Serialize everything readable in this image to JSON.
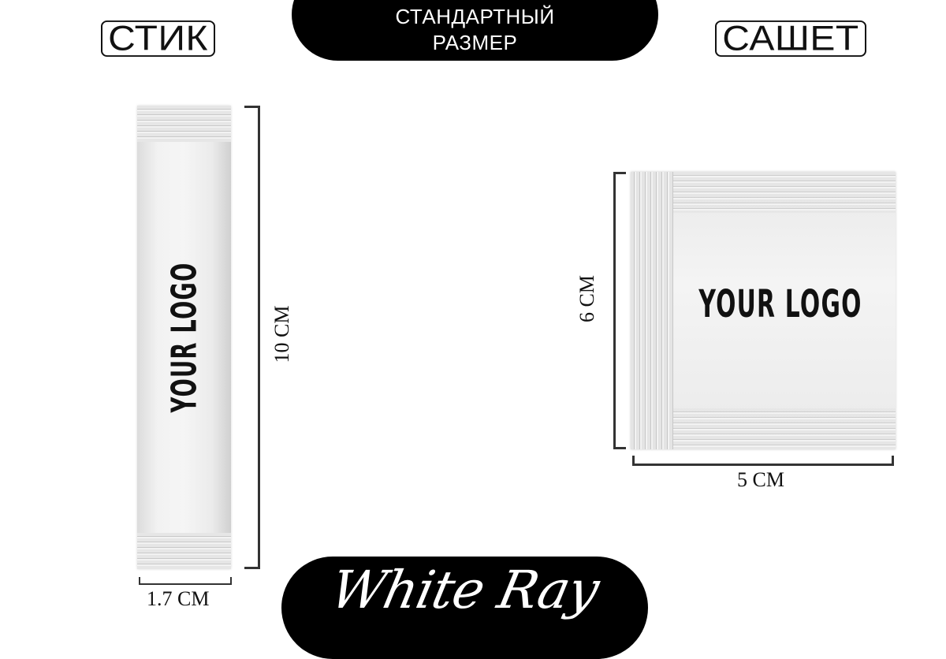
{
  "header": {
    "stick_label": "СТИК",
    "sachet_label": "САШЕТ",
    "center_line1": "СТАНДАРТНЫЙ",
    "center_line2": "РАЗМЕР"
  },
  "stick": {
    "logo_text": "YOUR LOGO",
    "height_label": "10 CM",
    "width_label": "1.7 CM"
  },
  "sachet": {
    "logo_text": "YOUR LOGO",
    "height_label": "6 CM",
    "width_label": "5 CM"
  },
  "footer": {
    "brand": "White Ray"
  }
}
